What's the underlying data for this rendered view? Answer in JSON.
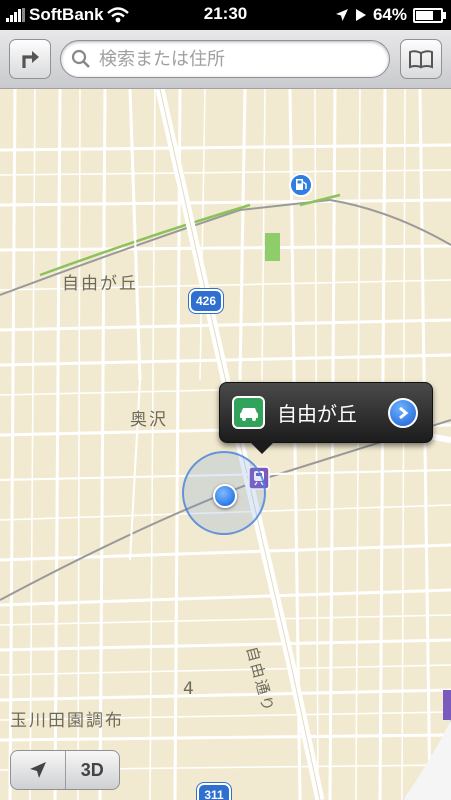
{
  "status_bar": {
    "carrier": "SoftBank",
    "time": "21:30",
    "battery": "64%"
  },
  "toolbar": {
    "search_placeholder": "検索または住所",
    "directions_icon": "turn-right-arrow-icon",
    "bookmarks_icon": "book-icon"
  },
  "map": {
    "labels": {
      "area_jiyugaoka": "自由が丘",
      "area_okusawa": "奥沢",
      "area_tamagawa": "玉川田園調布",
      "block_number": "4",
      "street_jiyu": "自由通り"
    },
    "route_shields": {
      "r426": "426",
      "r311": "311"
    },
    "pins": {
      "gas_station": "gas-station-icon",
      "station": "train-station-icon"
    }
  },
  "callout": {
    "title": "自由が丘",
    "left_icon": "car-icon",
    "right_icon": "detail-disclosure-icon"
  },
  "controls": {
    "mode_3d": "3D",
    "locate_icon": "location-arrow-icon"
  }
}
